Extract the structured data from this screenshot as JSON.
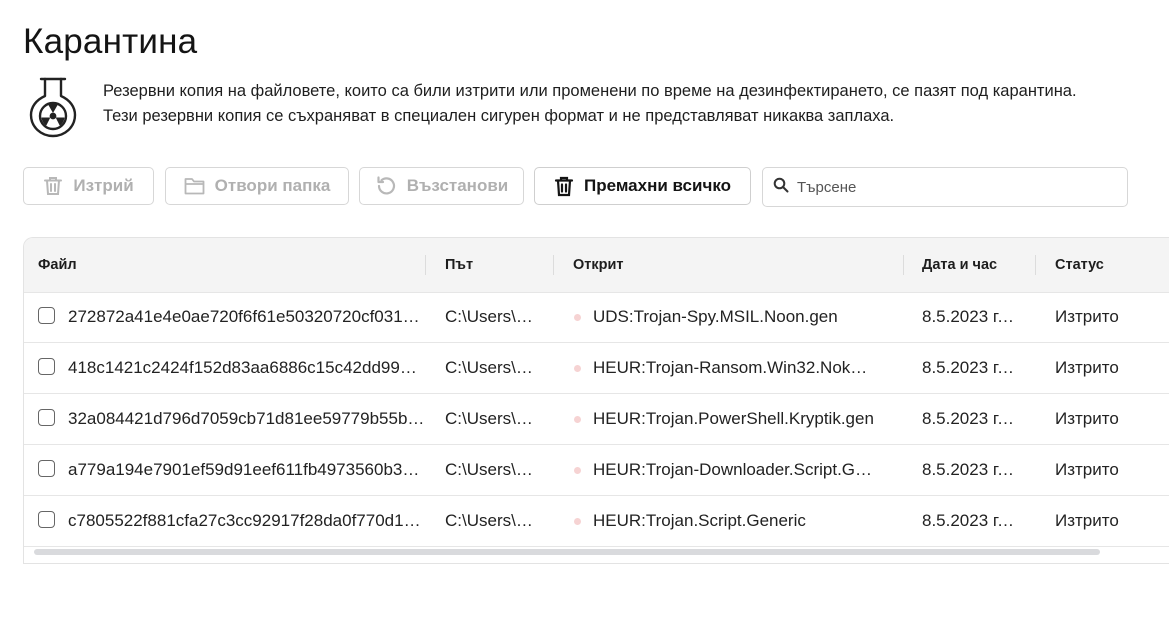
{
  "page": {
    "title": "Карантина",
    "description_line1": "Резервни копия на файловете, които са били изтрити или променени по време на дезинфектирането, се пазят под карантина.",
    "description_line2": "Тези резервни копия се съхраняват в специален сигурен формат и не представляват никаква заплаха.",
    "header_icon": "radioactive-flask-icon"
  },
  "toolbar": {
    "delete_label": "Изтрий",
    "delete_icon": "trash-icon",
    "open_folder_label": "Отвори папка",
    "open_folder_icon": "folder-icon",
    "restore_label": "Възстанови",
    "restore_icon": "restore-icon",
    "remove_all_label": "Премахни всичко",
    "remove_all_icon": "trash-icon",
    "search_placeholder": "Търсене",
    "search_value": "",
    "search_icon": "search-icon"
  },
  "table": {
    "columns": {
      "file": "Файл",
      "path": "Път",
      "detected": "Открит",
      "datetime": "Дата и час",
      "status": "Статус"
    },
    "rows": [
      {
        "file": "272872a41e4e0ae720f6f61e50320720cf0313…",
        "path": "C:\\Users\\…",
        "detected": "UDS:Trojan-Spy.MSIL.Noon.gen",
        "datetime": "8.5.2023 г.…",
        "status": "Изтрито"
      },
      {
        "file": "418c1421c2424f152d83aa6886c15c42dd994…",
        "path": "C:\\Users\\…",
        "detected": "HEUR:Trojan-Ransom.Win32.Noko…",
        "datetime": "8.5.2023 г.…",
        "status": "Изтрито"
      },
      {
        "file": "32a084421d796d7059cb71d81ee59779b55b…",
        "path": "C:\\Users\\…",
        "detected": "HEUR:Trojan.PowerShell.Kryptik.gen",
        "datetime": "8.5.2023 г.…",
        "status": "Изтрито"
      },
      {
        "file": "a779a194e7901ef59d91eef611fb4973560b3…",
        "path": "C:\\Users\\…",
        "detected": "HEUR:Trojan-Downloader.Script.G…",
        "datetime": "8.5.2023 г.…",
        "status": "Изтрито"
      },
      {
        "file": "c7805522f881cfa27c3cc92917f28da0f770d1…",
        "path": "C:\\Users\\…",
        "detected": "HEUR:Trojan.Script.Generic",
        "datetime": "8.5.2023 г.…",
        "status": "Изтрито"
      }
    ]
  },
  "colors": {
    "disabled_text": "#b0b0b0",
    "header_bg": "#f4f4f4",
    "threat_dot": "#f6d3d3"
  }
}
